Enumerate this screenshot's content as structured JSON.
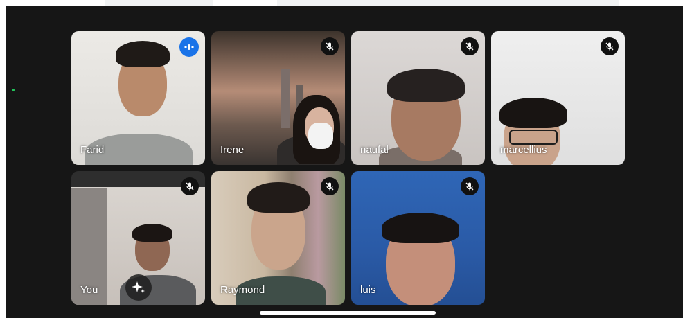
{
  "participants": [
    {
      "name": "Farid",
      "mic": "speaking",
      "status_icon": "speaking-indicator-icon"
    },
    {
      "name": "Irene",
      "mic": "muted",
      "status_icon": "mic-off-icon"
    },
    {
      "name": "naufal",
      "mic": "muted",
      "status_icon": "mic-off-icon"
    },
    {
      "name": "marcellius",
      "mic": "muted",
      "status_icon": "mic-off-icon"
    },
    {
      "name": "You",
      "mic": "muted",
      "status_icon": "mic-off-icon"
    },
    {
      "name": "Raymond",
      "mic": "muted",
      "status_icon": "mic-off-icon"
    },
    {
      "name": "luis",
      "mic": "muted",
      "status_icon": "mic-off-icon"
    }
  ],
  "self_tile_extra_icon": "sparkle-effects-icon",
  "colors": {
    "background": "#161616",
    "speaking_accent": "#1a73e8",
    "status_dot": "#22c35a"
  }
}
